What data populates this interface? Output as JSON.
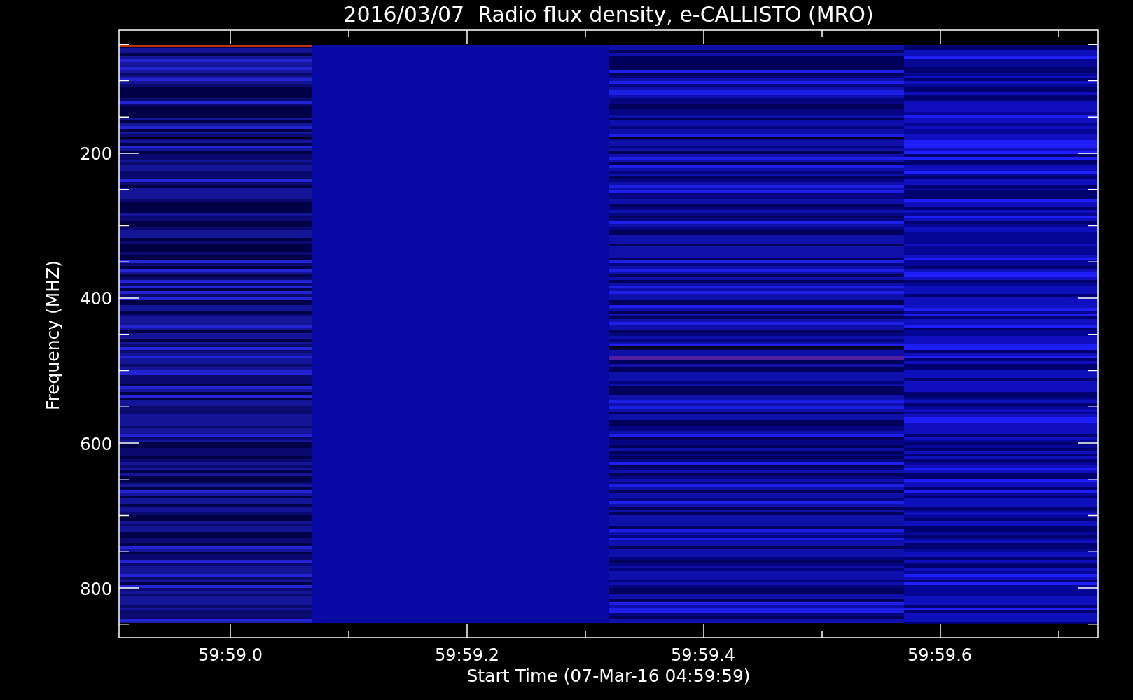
{
  "title": "2016/03/07  Radio flux density, e-CALLISTO (MRO)",
  "ylabel": "Frequency (MHZ)",
  "xlabel": "Start Time (07-Mar-16 04:59:59)",
  "yticks": [
    "200",
    "400",
    "600",
    "800"
  ],
  "xticks": [
    "59:59.0",
    "59:59.2",
    "59:59.4",
    "59:59.6"
  ]
}
